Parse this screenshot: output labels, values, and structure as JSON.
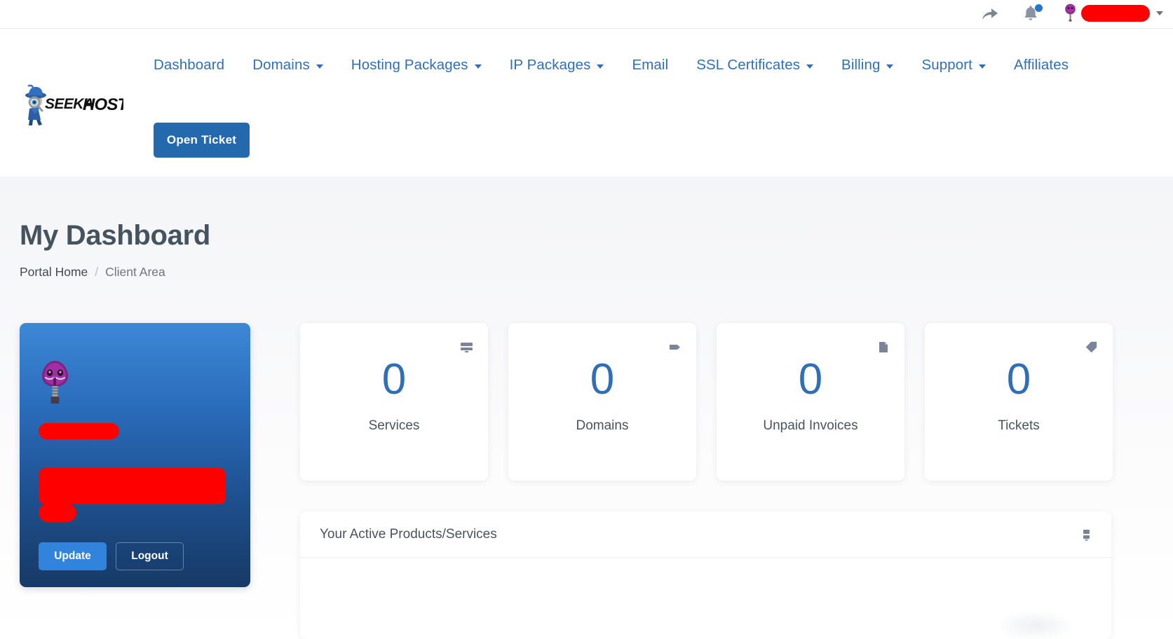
{
  "utility_bar": {
    "share_icon": "share-arrow-icon",
    "notifications_icon": "bell-icon",
    "notification_badge": "",
    "avatar_icon": "user-avatar-icon",
    "account_name": "",
    "account_caret": "chevron-down-icon"
  },
  "brand": {
    "name": "SEEKAHOST",
    "logo_icon": "seekahost-detective-logo"
  },
  "nav": {
    "items": [
      {
        "label": "Dashboard",
        "has_dropdown": false
      },
      {
        "label": "Domains",
        "has_dropdown": true
      },
      {
        "label": "Hosting Packages",
        "has_dropdown": true
      },
      {
        "label": "IP Packages",
        "has_dropdown": true
      },
      {
        "label": "Email",
        "has_dropdown": false
      },
      {
        "label": "SSL Certificates",
        "has_dropdown": true
      },
      {
        "label": "Billing",
        "has_dropdown": true
      },
      {
        "label": "Support",
        "has_dropdown": true
      },
      {
        "label": "Affiliates",
        "has_dropdown": false
      }
    ],
    "open_ticket_label": "Open Ticket"
  },
  "page": {
    "title": "My Dashboard",
    "breadcrumb": {
      "home": "Portal Home",
      "separator": "/",
      "current": "Client Area"
    }
  },
  "profile_card": {
    "avatar_icon": "purple-mushroom-avatar-icon",
    "username_redacted": "",
    "email_redacted": "",
    "extra_redacted": "",
    "update_label": "Update",
    "logout_label": "Logout"
  },
  "stats": [
    {
      "value": "0",
      "label": "Services",
      "icon": "server-icon"
    },
    {
      "value": "0",
      "label": "Domains",
      "icon": "tag-icon"
    },
    {
      "value": "0",
      "label": "Unpaid Invoices",
      "icon": "file-icon"
    },
    {
      "value": "0",
      "label": "Tickets",
      "icon": "ticket-tag-icon"
    }
  ],
  "products_panel": {
    "title": "Your Active Products/Services",
    "header_icon": "server-icon"
  },
  "colors": {
    "nav_link": "#2f6fba",
    "accent_blue": "#2468ad",
    "stat_number": "#2f6fba",
    "heading": "#44535e",
    "redaction": "#ff0000",
    "badge": "#2176d2"
  }
}
